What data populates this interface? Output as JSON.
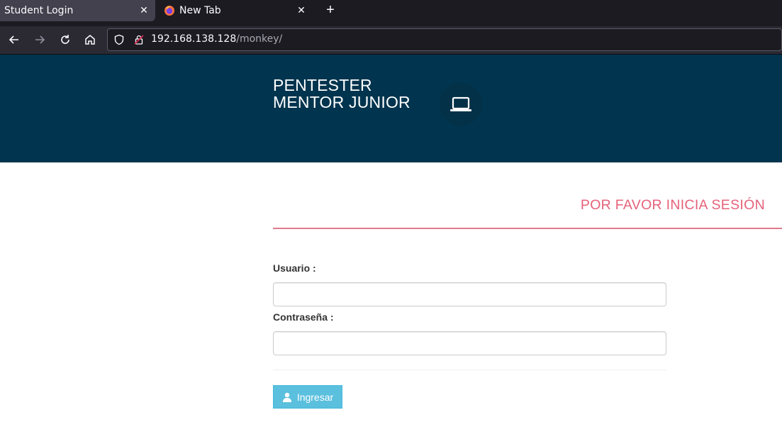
{
  "browser": {
    "tabs": [
      {
        "title": "Student Login",
        "active": true
      },
      {
        "title": "New Tab",
        "active": false
      }
    ],
    "close_glyph": "✕",
    "new_tab_glyph": "+",
    "url_host": "192.168.138.128",
    "url_path": "/monkey/"
  },
  "header": {
    "brand_line1": "PENTESTER",
    "brand_line2": "MENTOR JUNIOR",
    "icon": "laptop-icon",
    "bg_color": "#01344e"
  },
  "login": {
    "title": "POR FAVOR INICIA SESIÓN",
    "title_color": "#e5627a",
    "username_label": "Usuario :",
    "username_value": "",
    "password_label": "Contraseña :",
    "password_value": "",
    "submit_label": "Ingresar",
    "submit_icon": "user-icon",
    "submit_color": "#5bc0de"
  }
}
